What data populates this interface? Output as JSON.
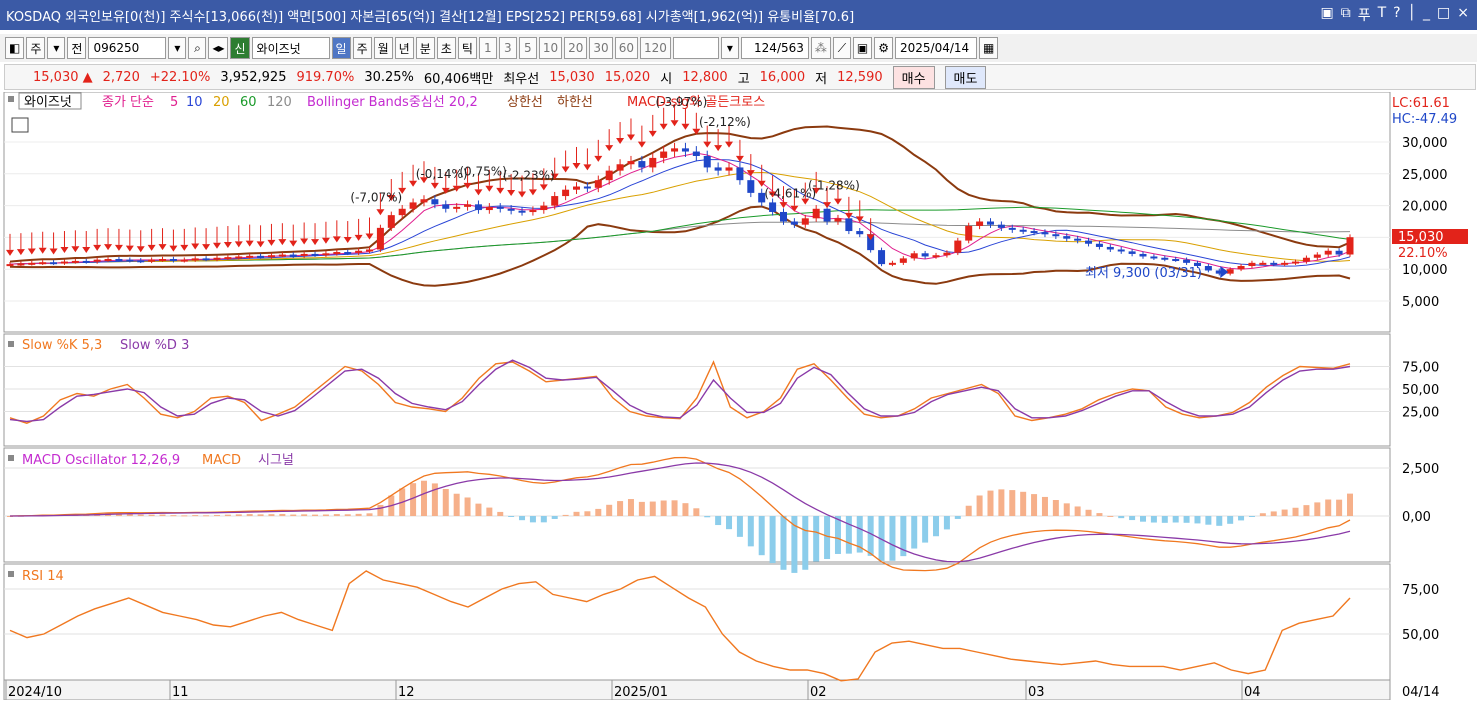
{
  "title": {
    "text": "KOSDAQ 외국인보유[0(천)] 주식수[13,066(천)] 액면[500] 자본금[65(억)] 결산[12월] EPS[252] PER[59.68] 시가총액[1,962(억)] 유통비율[70.6]",
    "controls": [
      "▣",
      "⧉",
      "푸",
      "T",
      "?",
      "│",
      "_",
      "□",
      "×"
    ]
  },
  "toolbar": {
    "market_type": "주",
    "range_label": "전",
    "code": "096250",
    "stock_badge": "신",
    "stock_name": "와이즈넛",
    "periods": [
      "일",
      "주",
      "월",
      "년",
      "분",
      "초",
      "틱"
    ],
    "active_period": "일",
    "intervals": [
      "1",
      "3",
      "5",
      "10",
      "20",
      "30",
      "60",
      "120"
    ],
    "bar_count": "124",
    "bar_total": "/563",
    "date": "2025/04/14"
  },
  "quote": {
    "price": "15,030 ▲",
    "change": "2,720",
    "change_pct": "+22.10%",
    "volume": "3,952,925",
    "volume_ratio": "919.70%",
    "turnover": "30.25%",
    "amount": "60,406백만",
    "best_bid_label": "최우선",
    "ask": "15,030",
    "bid": "15,020",
    "open_label": "시",
    "open": "12,800",
    "high_label": "고",
    "high": "16,000",
    "low_label": "저",
    "low": "12,590",
    "buy_label": "매수",
    "sell_label": "매도"
  },
  "colors": {
    "up": "#e2231a",
    "down": "#1f47c8",
    "bollinger": "#8b3a0f",
    "ma5": "#e0208f",
    "ma10": "#2a45d6",
    "ma20": "#d9a000",
    "ma60": "#1a9a2a",
    "ma120": "#8c8c8c",
    "stoch_k": "#f07820",
    "stoch_d": "#8a3aa8",
    "rsi": "#f07820"
  },
  "price_panel": {
    "legend": {
      "name": "와이즈넛",
      "ma_label": "종가 단순",
      "ma_periods": [
        "5",
        "10",
        "20",
        "60",
        "120"
      ],
      "bb_label": "Bollinger Bands중심선 20,2",
      "bb_upper": "상한선",
      "bb_lower": "하한선",
      "macd_sig": "MACD-sig와 골든크로스"
    },
    "lc": "LC:61.61",
    "hc": "HC:-47.49",
    "y_ticks": [
      "30,000",
      "25,000",
      "20,000",
      "15,000",
      "10,000",
      "5,000"
    ],
    "last_price": "15,030",
    "last_pct": "22.10%",
    "low_annotation": "최저 9,300 (03/31)",
    "signal_labels": [
      "(-7,07%)",
      "(-0,14%)",
      "(0,75%)",
      "(-2,23%)",
      "(-3,97%)",
      "(-2,12%)",
      "(-4,61%)",
      "(-1,28%)"
    ]
  },
  "stoch_panel": {
    "legend_k": "Slow %K 5,3",
    "legend_d": "Slow %D 3",
    "y_ticks": [
      "75,00",
      "50,00",
      "25,00"
    ]
  },
  "macd_panel": {
    "legend_osc": "MACD Oscillator 12,26,9",
    "legend_macd": "MACD",
    "legend_sig": "시그널",
    "y_ticks": [
      "2,500",
      "0,00"
    ]
  },
  "rsi_panel": {
    "legend": "RSI 14",
    "y_ticks": [
      "75,00",
      "50,00"
    ]
  },
  "x_axis": {
    "labels": [
      "2024/10",
      "11",
      "12",
      "2025/01",
      "02",
      "03",
      "04"
    ],
    "right_label": "04/14"
  },
  "chart_data": {
    "type": "line",
    "title": "",
    "close": [
      10800,
      10900,
      11000,
      11100,
      11000,
      11200,
      11300,
      11200,
      11500,
      11600,
      11500,
      11400,
      11300,
      11500,
      11600,
      11400,
      11500,
      11700,
      11600,
      11800,
      11900,
      12000,
      12100,
      12000,
      12200,
      12300,
      12100,
      12400,
      12300,
      12500,
      12700,
      12600,
      12900,
      13100,
      16500,
      18500,
      19500,
      20500,
      21000,
      20200,
      19500,
      19800,
      20200,
      19300,
      19800,
      19500,
      19200,
      19000,
      19300,
      20000,
      21500,
      22500,
      23000,
      22800,
      24000,
      25500,
      26500,
      27000,
      26000,
      27500,
      28500,
      29000,
      28500,
      27800,
      26000,
      25500,
      26000,
      24000,
      22000,
      20500,
      19000,
      17500,
      17000,
      18000,
      19500,
      17500,
      18000,
      16000,
      15500,
      13000,
      10800,
      11000,
      11700,
      12500,
      12000,
      12200,
      12600,
      14500,
      16800,
      17500,
      17000,
      16500,
      16200,
      16000,
      15800,
      15500,
      15200,
      14800,
      14500,
      14000,
      13500,
      13100,
      12800,
      12400,
      12000,
      11800,
      11600,
      11500,
      11000,
      10500,
      9800,
      9300,
      10000,
      10500,
      11000,
      11000,
      10800,
      11000,
      11200,
      11800,
      12300,
      12900,
      12310,
      15030
    ],
    "stoch_k": [
      18,
      12,
      20,
      38,
      45,
      42,
      50,
      55,
      40,
      22,
      18,
      25,
      40,
      42,
      35,
      15,
      22,
      30,
      45,
      60,
      75,
      70,
      55,
      35,
      30,
      28,
      25,
      40,
      62,
      78,
      80,
      70,
      58,
      60,
      62,
      64,
      40,
      25,
      20,
      18,
      17,
      40,
      80,
      30,
      18,
      25,
      40,
      72,
      78,
      60,
      40,
      22,
      18,
      20,
      28,
      40,
      45,
      50,
      55,
      45,
      20,
      15,
      18,
      22,
      28,
      38,
      45,
      50,
      48,
      30,
      22,
      18,
      20,
      24,
      35,
      52,
      65,
      75,
      74,
      73,
      78
    ],
    "stoch_d": [
      16,
      14,
      16,
      30,
      42,
      44,
      47,
      50,
      46,
      30,
      20,
      22,
      34,
      40,
      38,
      25,
      20,
      26,
      40,
      55,
      70,
      72,
      62,
      45,
      34,
      30,
      27,
      36,
      55,
      72,
      82,
      74,
      62,
      60,
      61,
      63,
      48,
      32,
      23,
      19,
      18,
      32,
      60,
      40,
      24,
      24,
      34,
      62,
      74,
      66,
      46,
      28,
      20,
      20,
      24,
      36,
      44,
      48,
      52,
      48,
      28,
      18,
      18,
      20,
      26,
      34,
      42,
      48,
      48,
      36,
      26,
      20,
      20,
      22,
      30,
      46,
      60,
      70,
      72,
      72,
      75
    ],
    "rsi": [
      52,
      48,
      50,
      55,
      60,
      64,
      67,
      70,
      66,
      62,
      60,
      58,
      55,
      54,
      57,
      60,
      62,
      58,
      55,
      52,
      78,
      85,
      80,
      78,
      76,
      72,
      68,
      65,
      70,
      75,
      78,
      79,
      72,
      70,
      68,
      72,
      75,
      80,
      82,
      76,
      70,
      65,
      50,
      40,
      35,
      32,
      30,
      30,
      28,
      24,
      25,
      40,
      45,
      46,
      44,
      42,
      42,
      40,
      38,
      36,
      35,
      34,
      33,
      34,
      35,
      33,
      32,
      32,
      32,
      30,
      32,
      34,
      30,
      28,
      30,
      52,
      56,
      58,
      60,
      70
    ]
  }
}
